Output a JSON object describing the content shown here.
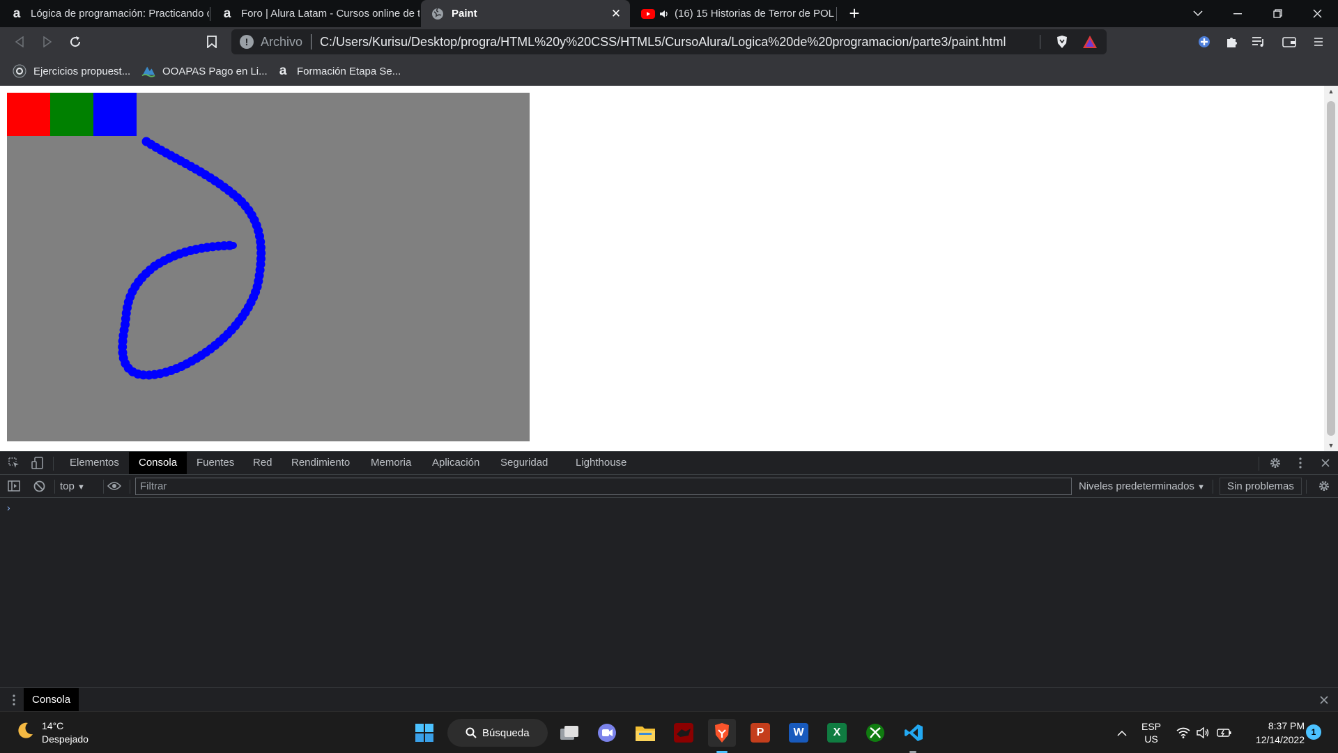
{
  "browser": {
    "tabs": [
      {
        "icon": "alura-icon",
        "title": "Lógica de programación: Practicando c",
        "active": false
      },
      {
        "icon": "alura-icon",
        "title": "Foro | Alura Latam - Cursos online de t",
        "active": false
      },
      {
        "icon": "globe-icon",
        "title": "Paint",
        "active": true
      },
      {
        "icon": "youtube-icon",
        "title": "(16) 15 Historias de Terror de POLI",
        "active": false
      }
    ],
    "address": {
      "scheme_label": "Archivo",
      "url": "C:/Users/Kurisu/Desktop/progra/HTML%20y%20CSS/HTML5/CursoAlura/Logica%20de%20programacion/parte3/paint.html"
    },
    "bookmarks": [
      {
        "icon": "site-icon",
        "label": "Ejercicios propuest..."
      },
      {
        "icon": "ooapas-icon",
        "label": "OOAPAS Pago en Li..."
      },
      {
        "icon": "alura-icon",
        "label": "Formación Etapa Se..."
      }
    ]
  },
  "page": {
    "palette": [
      "#ff0000",
      "#008000",
      "#0000ff"
    ],
    "canvas_background": "#808080",
    "stroke_color": "#0000ff"
  },
  "devtools": {
    "tabs": [
      "Elementos",
      "Consola",
      "Fuentes",
      "Red",
      "Rendimiento",
      "Memoria",
      "Aplicación",
      "Seguridad",
      "Lighthouse"
    ],
    "active_tab": "Consola",
    "context": "top",
    "filter_placeholder": "Filtrar",
    "levels": "Niveles predeterminados",
    "issues": "Sin problemas",
    "prompt": "›",
    "drawer_tab": "Consola"
  },
  "taskbar": {
    "weather": {
      "temp": "14°C",
      "condition": "Despejado"
    },
    "search_label": "Búsqueda",
    "lang": {
      "top": "ESP",
      "bottom": "US"
    },
    "time": "8:37 PM",
    "date": "12/14/2022",
    "notifications": "1"
  }
}
